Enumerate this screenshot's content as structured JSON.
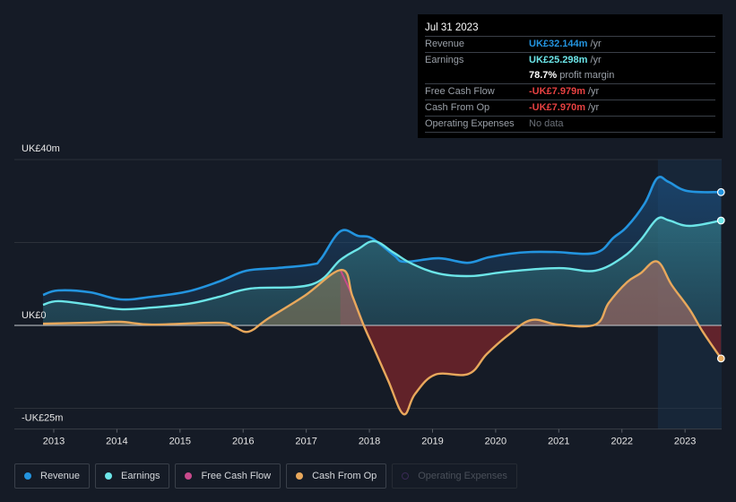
{
  "tooltip": {
    "date": "Jul 31 2023",
    "rows": [
      {
        "label": "Revenue",
        "value": "UK£32.144m",
        "unit": "/yr",
        "color": "#2394df"
      },
      {
        "label": "Earnings",
        "value": "UK£25.298m",
        "unit": "/yr",
        "color": "#6ce5e8"
      },
      {
        "label": "",
        "value": "78.7%",
        "unit": "profit margin",
        "color": "#ffffff"
      },
      {
        "label": "Free Cash Flow",
        "value": "-UK£7.979m",
        "unit": "/yr",
        "color": "#e64141"
      },
      {
        "label": "Cash From Op",
        "value": "-UK£7.970m",
        "unit": "/yr",
        "color": "#e64141"
      },
      {
        "label": "Operating Expenses",
        "value": "No data",
        "unit": "",
        "color": "#6b7078"
      }
    ]
  },
  "legend": [
    {
      "label": "Revenue",
      "color": "#2394df",
      "enabled": true
    },
    {
      "label": "Earnings",
      "color": "#6ce5e8",
      "enabled": true
    },
    {
      "label": "Free Cash Flow",
      "color": "#c94a8c",
      "enabled": true
    },
    {
      "label": "Cash From Op",
      "color": "#e8a85c",
      "enabled": true
    },
    {
      "label": "Operating Expenses",
      "color": "#3a2a55",
      "enabled": false
    }
  ],
  "chart_data": {
    "type": "area",
    "title": "",
    "xlabel": "",
    "ylabel": "",
    "currency": "UK£",
    "xlim": [
      2012.83,
      2023.58
    ],
    "ylim": [
      -25,
      40
    ],
    "y_tick_labels": [
      {
        "value": 40,
        "label": "UK£40m"
      },
      {
        "value": 0,
        "label": "UK£0"
      },
      {
        "value": -25,
        "label": "-UK£25m"
      }
    ],
    "gridlines": [
      40,
      20,
      0,
      -20
    ],
    "x_ticks": [
      2013,
      2014,
      2015,
      2016,
      2017,
      2018,
      2019,
      2020,
      2021,
      2022,
      2023
    ],
    "highlight_range": [
      2022.57,
      2023.58
    ],
    "series": [
      {
        "name": "Revenue",
        "color": "#2394df",
        "points": [
          [
            2012.83,
            7.35
          ],
          [
            2013.07,
            8.43
          ],
          [
            2013.57,
            8.0
          ],
          [
            2014.06,
            6.27
          ],
          [
            2014.56,
            6.92
          ],
          [
            2015.13,
            8.22
          ],
          [
            2015.62,
            10.6
          ],
          [
            2016.05,
            13.19
          ],
          [
            2016.55,
            13.84
          ],
          [
            2017.09,
            14.7
          ],
          [
            2017.23,
            16.0
          ],
          [
            2017.54,
            22.7
          ],
          [
            2017.82,
            21.6
          ],
          [
            2018.04,
            21.0
          ],
          [
            2018.39,
            16.9
          ],
          [
            2018.56,
            15.35
          ],
          [
            2019.1,
            16.2
          ],
          [
            2019.55,
            15.1
          ],
          [
            2019.88,
            16.4
          ],
          [
            2020.23,
            17.3
          ],
          [
            2020.55,
            17.7
          ],
          [
            2020.94,
            17.7
          ],
          [
            2021.58,
            17.5
          ],
          [
            2021.87,
            21.2
          ],
          [
            2022.08,
            23.8
          ],
          [
            2022.36,
            29.4
          ],
          [
            2022.56,
            35.5
          ],
          [
            2022.74,
            34.6
          ],
          [
            2023.04,
            32.4
          ],
          [
            2023.57,
            32.144
          ]
        ]
      },
      {
        "name": "Earnings",
        "color": "#6ce5e8",
        "points": [
          [
            2012.83,
            4.97
          ],
          [
            2013.07,
            5.84
          ],
          [
            2013.57,
            4.97
          ],
          [
            2014.06,
            3.9
          ],
          [
            2014.56,
            4.3
          ],
          [
            2015.13,
            5.2
          ],
          [
            2015.62,
            6.9
          ],
          [
            2016.12,
            8.9
          ],
          [
            2017.09,
            9.9
          ],
          [
            2017.54,
            15.8
          ],
          [
            2017.82,
            18.4
          ],
          [
            2018.08,
            20.3
          ],
          [
            2018.39,
            17.5
          ],
          [
            2018.67,
            14.9
          ],
          [
            2019.1,
            12.5
          ],
          [
            2019.6,
            11.9
          ],
          [
            2020.09,
            12.8
          ],
          [
            2020.66,
            13.6
          ],
          [
            2021.08,
            13.8
          ],
          [
            2021.58,
            13.2
          ],
          [
            2022.01,
            16.4
          ],
          [
            2022.29,
            20.5
          ],
          [
            2022.56,
            25.7
          ],
          [
            2022.75,
            25.3
          ],
          [
            2023.07,
            24.0
          ],
          [
            2023.57,
            25.298
          ]
        ]
      },
      {
        "name": "Free Cash Flow",
        "color": "#c94a8c",
        "points": [
          [
            2017.54,
            13.4
          ],
          [
            2017.73,
            7.1
          ],
          [
            2017.91,
            0
          ],
          [
            2018.08,
            -5.8
          ],
          [
            2018.3,
            -13.4
          ],
          [
            2018.54,
            -21.4
          ],
          [
            2018.72,
            -16.6
          ],
          [
            2019.04,
            -11.9
          ],
          [
            2019.57,
            -11.7
          ],
          [
            2019.86,
            -6.9
          ],
          [
            2020.21,
            -2.2
          ],
          [
            2020.57,
            1.3
          ],
          [
            2020.99,
            0.2
          ],
          [
            2021.58,
            0.2
          ],
          [
            2021.79,
            5.4
          ],
          [
            2022.08,
            10.4
          ],
          [
            2022.29,
            12.5
          ],
          [
            2022.56,
            15.4
          ],
          [
            2022.79,
            9.7
          ],
          [
            2023.07,
            3.9
          ],
          [
            2023.28,
            -1.5
          ],
          [
            2023.57,
            -7.979
          ]
        ]
      },
      {
        "name": "Cash From Op",
        "color": "#e8a85c",
        "points": [
          [
            2012.83,
            0.4
          ],
          [
            2013.57,
            0.65
          ],
          [
            2014.06,
            0.86
          ],
          [
            2014.56,
            0.2
          ],
          [
            2015.62,
            0.65
          ],
          [
            2015.86,
            -0.4
          ],
          [
            2016.09,
            -1.5
          ],
          [
            2016.4,
            1.7
          ],
          [
            2016.97,
            7.1
          ],
          [
            2017.56,
            13.4
          ],
          [
            2017.73,
            7.1
          ],
          [
            2017.91,
            0
          ],
          [
            2018.08,
            -5.8
          ],
          [
            2018.3,
            -13.4
          ],
          [
            2018.54,
            -21.4
          ],
          [
            2018.72,
            -16.6
          ],
          [
            2019.04,
            -11.9
          ],
          [
            2019.57,
            -11.7
          ],
          [
            2019.86,
            -6.9
          ],
          [
            2020.21,
            -2.2
          ],
          [
            2020.57,
            1.3
          ],
          [
            2020.99,
            0.2
          ],
          [
            2021.58,
            0.2
          ],
          [
            2021.79,
            5.4
          ],
          [
            2022.08,
            10.4
          ],
          [
            2022.29,
            12.5
          ],
          [
            2022.56,
            15.4
          ],
          [
            2022.79,
            9.7
          ],
          [
            2023.07,
            3.9
          ],
          [
            2023.28,
            -1.5
          ],
          [
            2023.57,
            -7.97
          ]
        ]
      }
    ]
  }
}
